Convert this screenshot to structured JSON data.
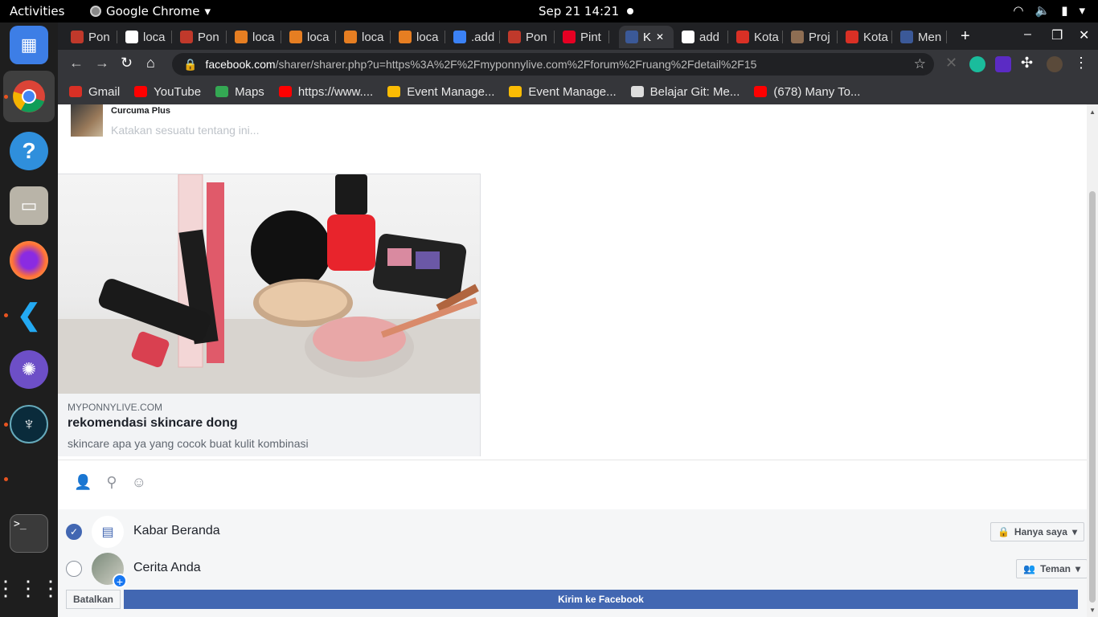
{
  "topbar": {
    "activities": "Activities",
    "app_name": "Google Chrome",
    "clock": "Sep 21  14:21"
  },
  "tabs": [
    {
      "label": "Pon",
      "color": "#c0392b"
    },
    {
      "label": "loca",
      "color": "#ffffff"
    },
    {
      "label": "Pon",
      "color": "#c0392b"
    },
    {
      "label": "loca",
      "color": "#e67e22"
    },
    {
      "label": "loca",
      "color": "#e67e22"
    },
    {
      "label": "loca",
      "color": "#e67e22"
    },
    {
      "label": "loca",
      "color": "#e67e22"
    },
    {
      "label": ".add",
      "color": "#3b82f6"
    },
    {
      "label": "Pon",
      "color": "#c0392b"
    },
    {
      "label": "Pint",
      "color": "#e60023"
    },
    {
      "label": "K",
      "color": "#3b5998"
    },
    {
      "label": "add",
      "color": "#ffffff"
    },
    {
      "label": "Kota",
      "color": "#d93025"
    },
    {
      "label": "Proj",
      "color": "#8e6e53"
    },
    {
      "label": "Kota",
      "color": "#d93025"
    },
    {
      "label": "Men",
      "color": "#3b5998"
    }
  ],
  "toolbar": {
    "url_host": "facebook.com",
    "url_path": "/sharer/sharer.php?u=https%3A%2F%2Fmyponnylive.com%2Fforum%2Fruang%2Fdetail%2F15"
  },
  "bookmarks": [
    {
      "label": "Gmail",
      "color": "#d93025"
    },
    {
      "label": "YouTube",
      "color": "#ff0000"
    },
    {
      "label": "Maps",
      "color": "#34a853"
    },
    {
      "label": "https://www....",
      "color": "#ff0000"
    },
    {
      "label": "Event Manage...",
      "color": "#fbbc04"
    },
    {
      "label": "Event Manage...",
      "color": "#fbbc04"
    },
    {
      "label": "Belajar Git: Me...",
      "color": "#dddddd"
    },
    {
      "label": "(678) Many To...",
      "color": "#ff0000"
    }
  ],
  "composer": {
    "page_name": "Curcuma Plus",
    "placeholder": "Katakan sesuatu tentang ini..."
  },
  "preview": {
    "domain": "MYPONNYLIVE.COM",
    "title": "rekomendasi skincare dong",
    "description": "skincare apa ya yang cocok buat kulit kombinasi"
  },
  "share_targets": [
    {
      "label": "Kabar Beranda",
      "checked": true,
      "privacy": "Hanya saya"
    },
    {
      "label": "Cerita Anda",
      "checked": false,
      "privacy": "Teman"
    }
  ],
  "buttons": {
    "cancel": "Batalkan",
    "share": "Kirim ke Facebook"
  },
  "colors": {
    "facebook_blue": "#4267b2",
    "chrome_dark": "#35363a"
  }
}
